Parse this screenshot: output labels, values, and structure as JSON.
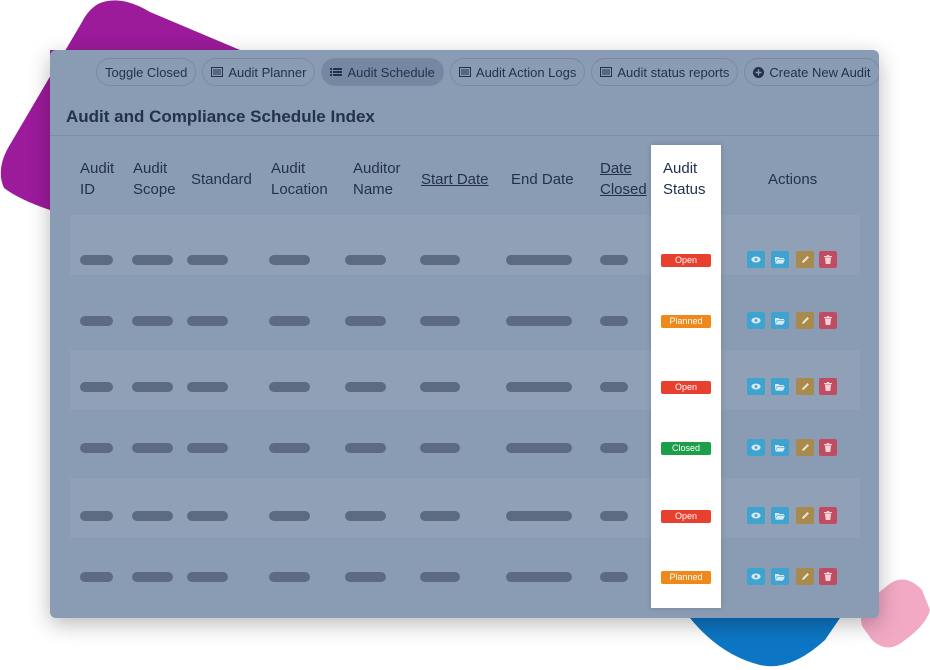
{
  "toolbar": {
    "buttons": [
      {
        "label": "Toggle Closed",
        "icon": ""
      },
      {
        "label": "Audit Planner",
        "icon": "list-alt-icon"
      },
      {
        "label": "Audit Schedule",
        "icon": "list-icon",
        "active": true
      },
      {
        "label": "Audit Action Logs",
        "icon": "list-alt-icon"
      },
      {
        "label": "Audit status reports",
        "icon": "list-alt-icon"
      },
      {
        "label": "Create New Audit",
        "icon": "plus-circle-icon"
      }
    ]
  },
  "page": {
    "title_bold": "Audit and Compliance Schedule",
    "title_rest": " Index"
  },
  "table": {
    "headers": [
      {
        "line1": "Audit",
        "line2": "ID",
        "sortable": false
      },
      {
        "line1": "Audit",
        "line2": "Scope",
        "sortable": false
      },
      {
        "line1": "Standard",
        "line2": "",
        "sortable": false
      },
      {
        "line1": "Audit",
        "line2": "Location",
        "sortable": false
      },
      {
        "line1": "Auditor",
        "line2": "Name",
        "sortable": false
      },
      {
        "line1": "Start Date",
        "line2": "",
        "sortable": true
      },
      {
        "line1": "End Date",
        "line2": "",
        "sortable": false
      },
      {
        "line1": "Date",
        "line2": "Closed",
        "sortable": true
      },
      {
        "line1": "Audit",
        "line2": "Status",
        "sortable": false
      },
      {
        "line1": "Actions",
        "line2": "",
        "sortable": false
      }
    ],
    "rows": [
      {
        "status": "Open"
      },
      {
        "status": "Planned"
      },
      {
        "status": "Open"
      },
      {
        "status": "Closed"
      },
      {
        "status": "Open"
      },
      {
        "status": "Planned"
      }
    ],
    "action_icons": [
      "eye-icon",
      "folder-open-icon",
      "pencil-icon",
      "trash-icon"
    ]
  },
  "colors": {
    "Open": "#e8402f",
    "Planned": "#f0891c",
    "Closed": "#1d9e4b",
    "view": "#3fa3cf",
    "folder": "#3fa3cf",
    "edit": "#a88a4f",
    "delete": "#c04c62"
  }
}
